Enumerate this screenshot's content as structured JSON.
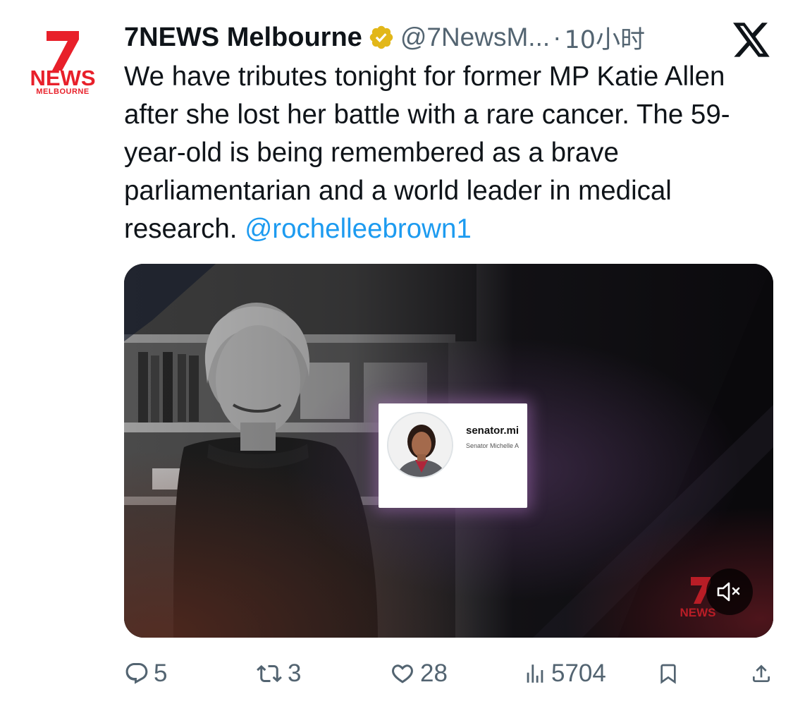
{
  "account": {
    "name": "7NEWS Melbourne",
    "handle": "@7NewsM...",
    "separator": "·",
    "time": "10小时",
    "verified": true,
    "avatar_text_1": "NEWS",
    "avatar_text_2": "MELBOURNE"
  },
  "tweet": {
    "text": "We have tributes tonight for former MP Katie Allen after she lost her battle with a rare cancer. The 59-year-old is being remembered as a brave parliamentarian and a world leader in medical research. ",
    "mention": "@rochelleebrown1"
  },
  "media": {
    "card_username": "senator.mi",
    "card_fullname": "Senator Michelle A",
    "watermark_text": "NEWS",
    "mute_icon": "speaker-muted-icon"
  },
  "actions": {
    "replies": "5",
    "retweets": "3",
    "likes": "28",
    "views": "5704"
  },
  "colors": {
    "accent": "#1d9bf0",
    "secondary_text": "#536471",
    "brand_red": "#e8202a",
    "verified_gold": "#e2b719"
  }
}
